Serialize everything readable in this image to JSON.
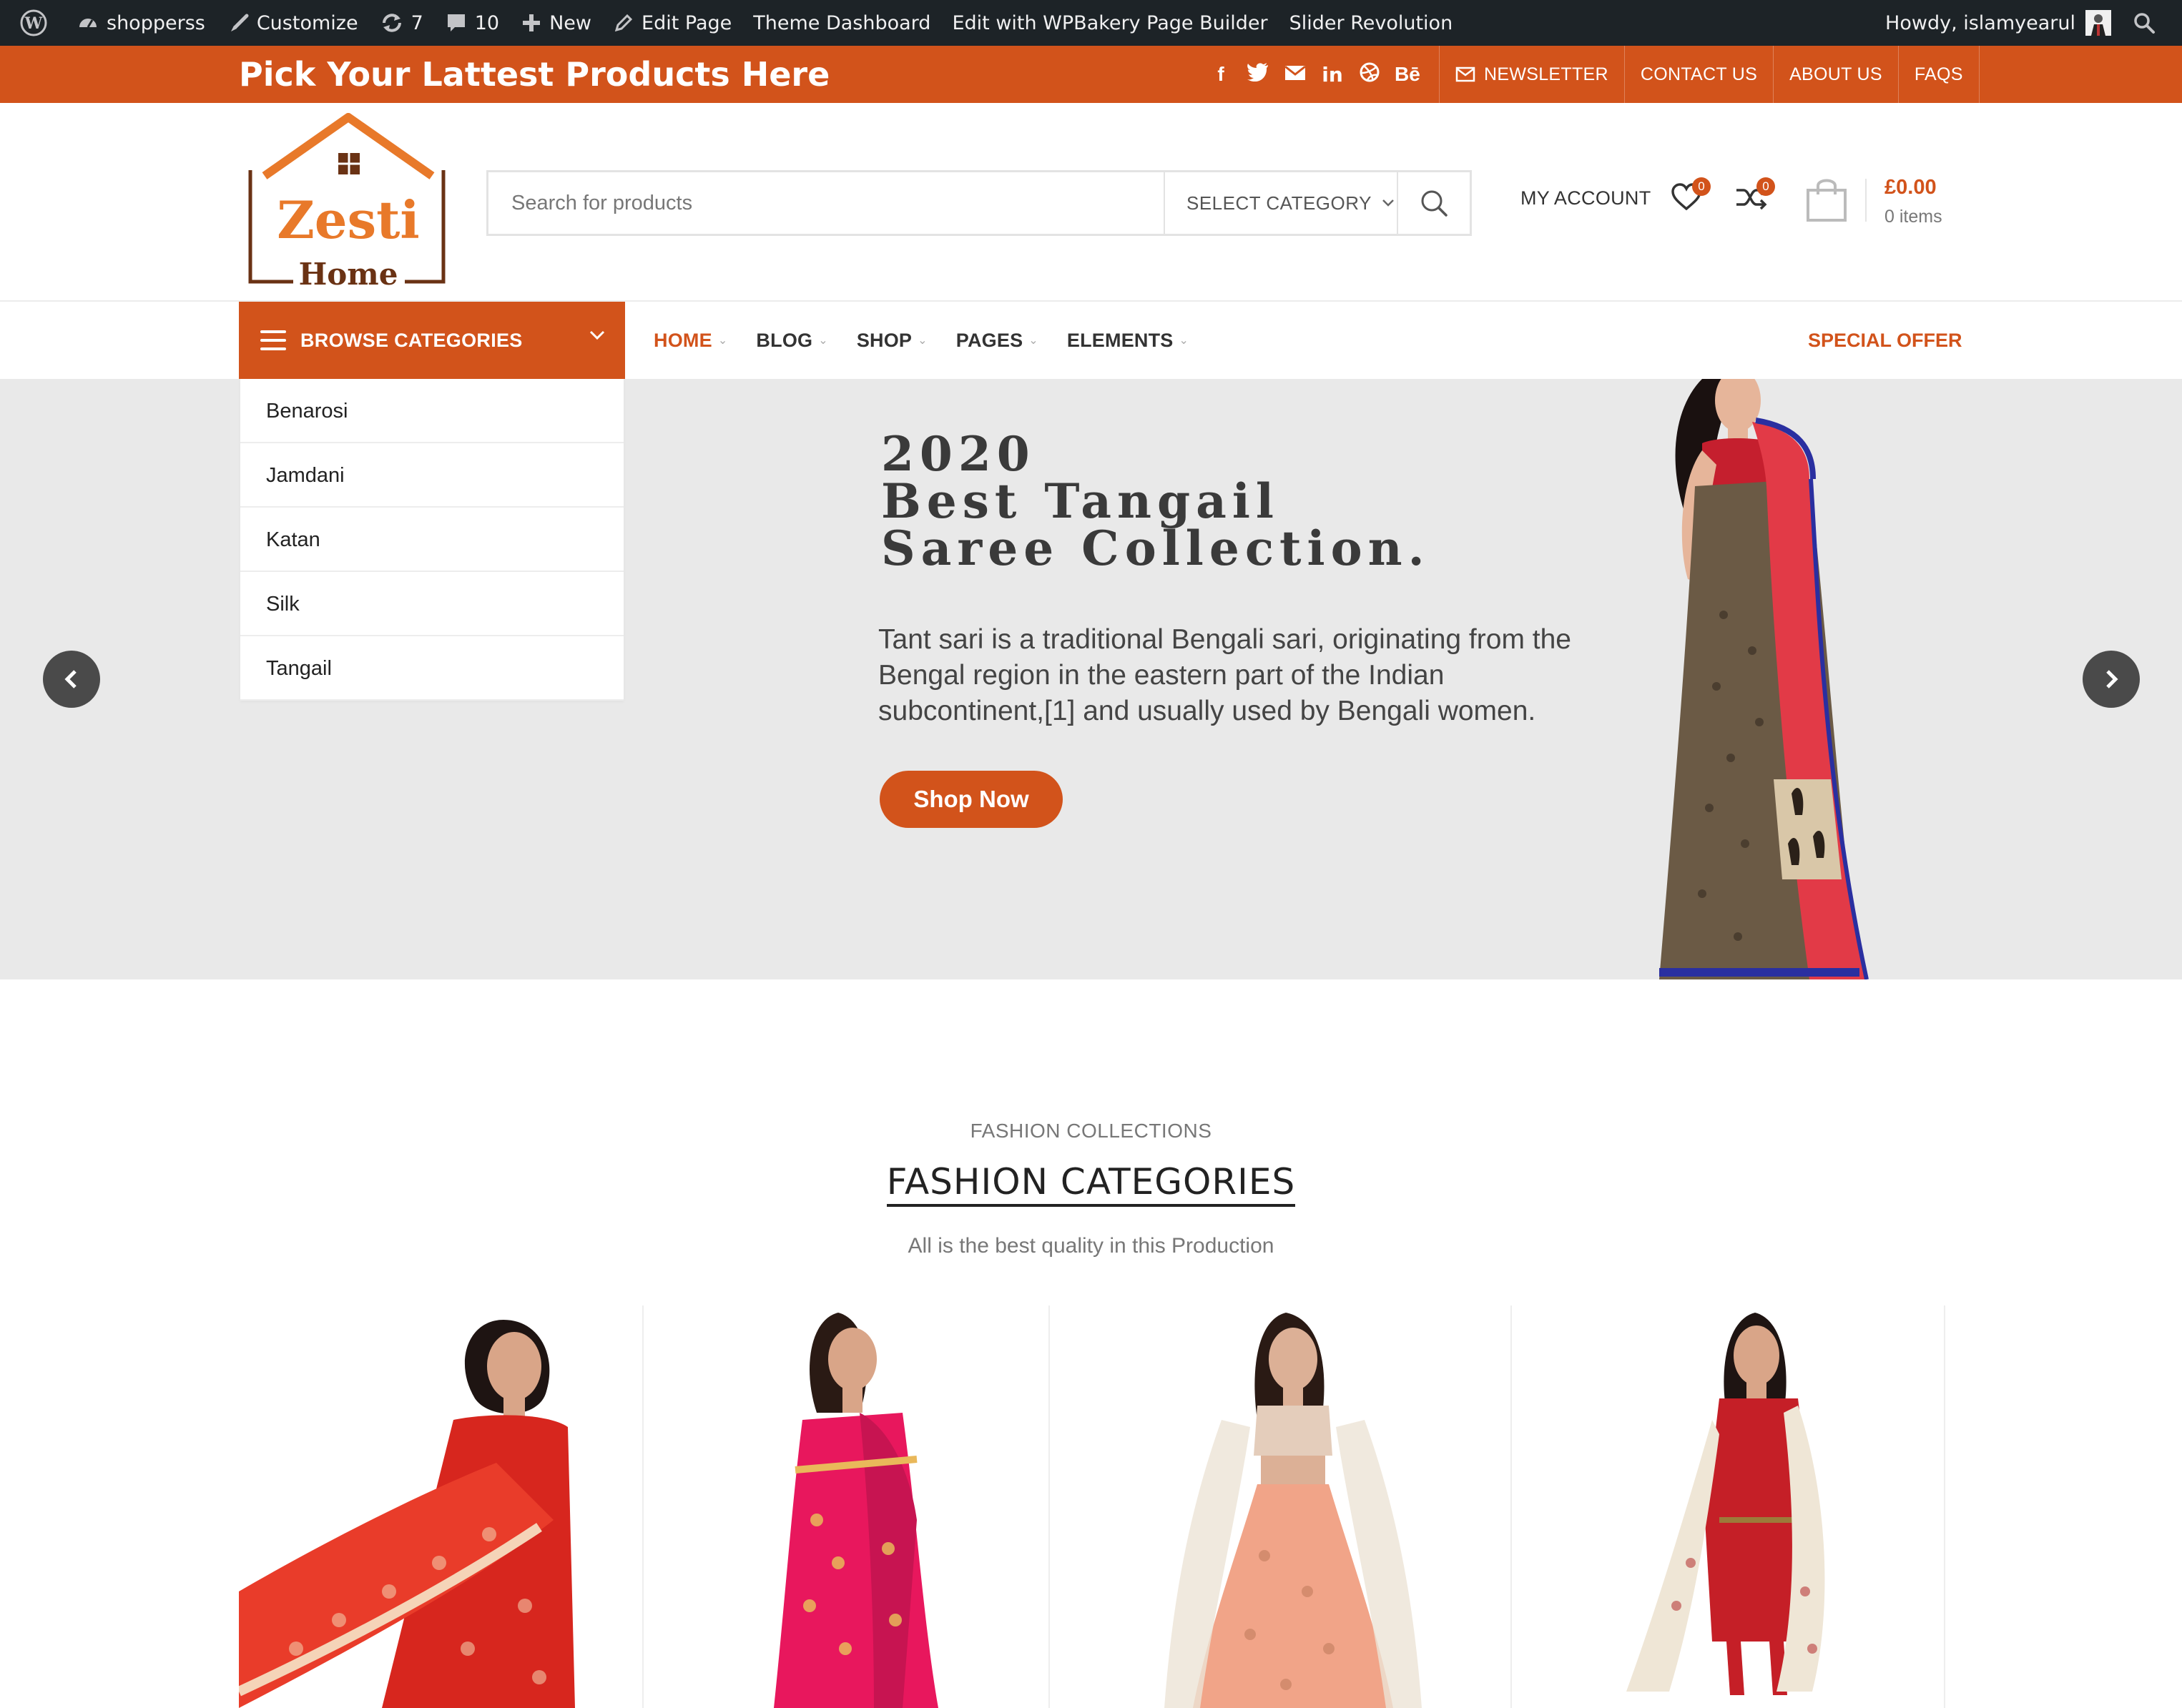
{
  "adminbar": {
    "site_name": "shopperss",
    "customize": "Customize",
    "updates_count": "7",
    "comments_count": "10",
    "new": "New",
    "edit_page": "Edit Page",
    "theme_dashboard": "Theme Dashboard",
    "wpbakery": "Edit with WPBakery Page Builder",
    "slider_revolution": "Slider Revolution",
    "howdy": "Howdy, islamyearul"
  },
  "topbar": {
    "promo": "Pick Your Lattest Products Here",
    "socials": [
      "f",
      "facebook-icon",
      "twitter-icon",
      "email-icon",
      "linkedin-icon",
      "dribbble-icon",
      "Bē"
    ],
    "links": {
      "newsletter": "NEWSLETTER",
      "contact": "CONTACT US",
      "about": "ABOUT US",
      "faqs": "FAQS"
    }
  },
  "header": {
    "logo_text_top": "Zesti",
    "logo_text_bottom": "Home",
    "search_placeholder": "Search for products",
    "select_category": "SELECT CATEGORY",
    "my_account": "MY ACCOUNT",
    "wishlist_count": "0",
    "compare_count": "0",
    "cart_total": "£0.00",
    "cart_items": "0 items"
  },
  "nav": {
    "browse": "BROWSE CATEGORIES",
    "menu": {
      "home": "HOME",
      "blog": "BLOG",
      "shop": "SHOP",
      "pages": "PAGES",
      "elements": "ELEMENTS"
    },
    "special_offer": "SPECIAL OFFER"
  },
  "categories": [
    "Benarosi",
    "Jamdani",
    "Katan",
    "Silk",
    "Tangail"
  ],
  "slide": {
    "line1": "2020",
    "line2": "Best Tangail",
    "line3": "Saree Collection.",
    "description": "Tant sari is a traditional Bengali sari, originating from the Bengal region in the eastern part of the Indian subcontinent,[1] and usually used by Bengali women.",
    "button": "Shop Now"
  },
  "fashion": {
    "subtitle": "FASHION COLLECTIONS",
    "title": "FASHION CATEGORIES",
    "description": "All is the best quality in this Production"
  },
  "colors": {
    "accent": "#d2531b",
    "adminbar": "#1d2327",
    "slider_bg": "#e9e9e9"
  }
}
